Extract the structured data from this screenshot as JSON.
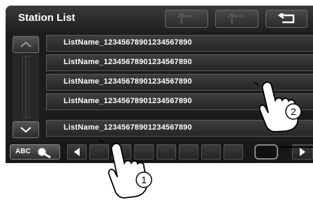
{
  "header": {
    "title": "Station List"
  },
  "station_list": {
    "items": [
      "ListName_12345678901234567890",
      "ListName_12345678901234567890",
      "ListName_12345678901234567890",
      "ListName_12345678901234567890",
      "ListName_12345678901234567890"
    ]
  },
  "bottom_bar": {
    "abc_label": "ABC"
  },
  "callouts": {
    "step1": "1",
    "step2": "2"
  },
  "icons": {
    "header": [
      "return-arrow-icon",
      "return-arrow-icon",
      "back-arrow-icon"
    ],
    "scroll": [
      "chevron-up-icon",
      "chevron-down-icon"
    ],
    "bottom": [
      "search-magnifier-icon",
      "triangle-left-icon",
      "triangle-right-icon"
    ]
  },
  "colors": {
    "screen_bg": "#1c1c1c",
    "row_border": "#5a5a5a",
    "text": "#ffffff"
  }
}
